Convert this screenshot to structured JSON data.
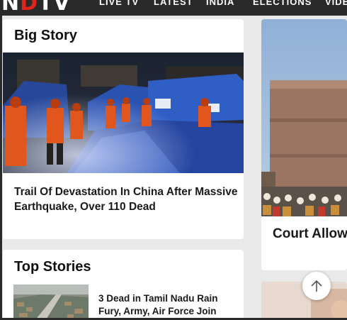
{
  "header": {
    "logo_text": "NDTV",
    "nav": [
      "LIVE TV",
      "LATEST",
      "INDIA",
      "ELECTIONS",
      "VIDEO"
    ]
  },
  "big_story": {
    "title": "Big Story",
    "image_icon": "earthquake-rescue-photo",
    "headline": "Trail Of Devastation In China After Massive Earthquake, Over 110 Dead"
  },
  "side_story": {
    "image_icon": "court-building-photo",
    "headline": "Court Allow"
  },
  "top_stories": {
    "title": "Top Stories",
    "items": [
      {
        "image_icon": "flood-aerial-photo",
        "headline": "3 Dead in Tamil Nadu Rain Fury, Army, Air Force Join"
      }
    ]
  },
  "scroll_top": {
    "icon": "arrow-up-icon"
  }
}
